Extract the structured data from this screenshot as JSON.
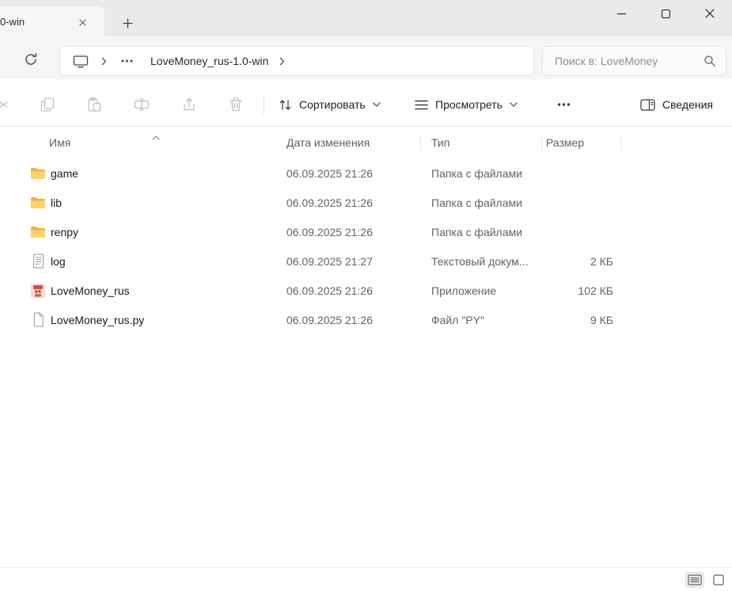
{
  "window": {
    "tab_title": "0-win"
  },
  "nav": {
    "breadcrumb_folder": "LoveMoney_rus-1.0-win",
    "search_placeholder": "Поиск в: LoveMoney"
  },
  "toolbar": {
    "sort_label": "Сортировать",
    "view_label": "Просмотреть",
    "details_label": "Сведения"
  },
  "columns": {
    "name": "Имя",
    "date": "Дата изменения",
    "type": "Тип",
    "size": "Размер"
  },
  "files": [
    {
      "name": "game",
      "date": "06.09.2025 21:26",
      "type": "Папка с файлами",
      "size": "",
      "icon": "folder"
    },
    {
      "name": "lib",
      "date": "06.09.2025 21:26",
      "type": "Папка с файлами",
      "size": "",
      "icon": "folder"
    },
    {
      "name": "renpy",
      "date": "06.09.2025 21:26",
      "type": "Папка с файлами",
      "size": "",
      "icon": "folder"
    },
    {
      "name": "log",
      "date": "06.09.2025 21:27",
      "type": "Текстовый докум...",
      "size": "2 КБ",
      "icon": "text"
    },
    {
      "name": "LoveMoney_rus",
      "date": "06.09.2025 21:26",
      "type": "Приложение",
      "size": "102 КБ",
      "icon": "app"
    },
    {
      "name": "LoveMoney_rus.py",
      "date": "06.09.2025 21:26",
      "type": "Файл \"PY\"",
      "size": "9 КБ",
      "icon": "py"
    }
  ],
  "colors": {
    "folder_yellow": "#ffd368",
    "secondary_text": "#636363",
    "disabled_icon": "#bdbfc2"
  }
}
